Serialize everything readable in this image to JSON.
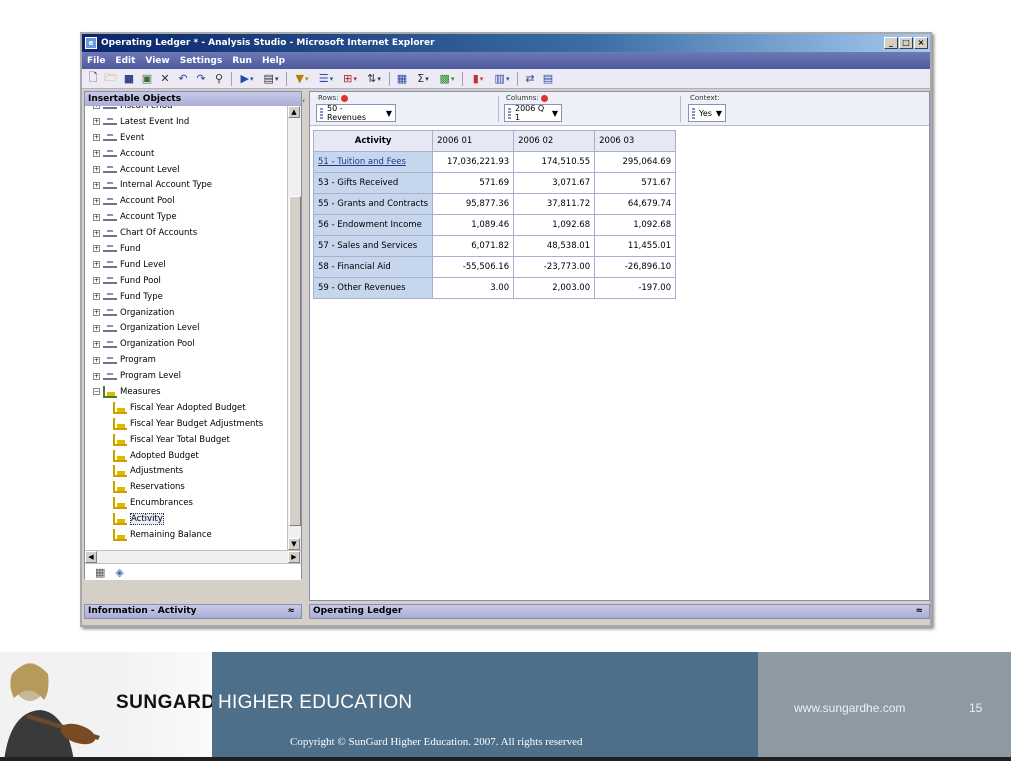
{
  "window": {
    "title": "Operating Ledger * - Analysis Studio - Microsoft Internet Explorer"
  },
  "menu": [
    "File",
    "Edit",
    "View",
    "Settings",
    "Run",
    "Help"
  ],
  "toolbar_icons": [
    "new-icon",
    "open-icon",
    "save-icon",
    "save-as-icon",
    "delete-icon",
    "undo-icon",
    "redo-icon",
    "find-icon",
    "run-icon",
    "export-icon",
    "filter-icon",
    "suppress-icon",
    "calc-icon",
    "sort-icon",
    "rank-icon",
    "sum-icon",
    "explore-icon",
    "chart-icon",
    "chart-type-icon",
    "swap-icon",
    "properties-icon"
  ],
  "insertable": {
    "title": "Insertable Objects",
    "items": [
      {
        "label": "Fiscal Period",
        "kind": "dim",
        "level": 1
      },
      {
        "label": "Latest Event Ind",
        "kind": "dim",
        "level": 1
      },
      {
        "label": "Event",
        "kind": "dim",
        "level": 1
      },
      {
        "label": "Account",
        "kind": "dim",
        "level": 1
      },
      {
        "label": "Account Level",
        "kind": "dim",
        "level": 1
      },
      {
        "label": "Internal Account Type",
        "kind": "dim",
        "level": 1
      },
      {
        "label": "Account Pool",
        "kind": "dim",
        "level": 1
      },
      {
        "label": "Account Type",
        "kind": "dim",
        "level": 1
      },
      {
        "label": "Chart Of Accounts",
        "kind": "dim",
        "level": 1
      },
      {
        "label": "Fund",
        "kind": "dim",
        "level": 1
      },
      {
        "label": "Fund Level",
        "kind": "dim",
        "level": 1
      },
      {
        "label": "Fund Pool",
        "kind": "dim",
        "level": 1
      },
      {
        "label": "Fund Type",
        "kind": "dim",
        "level": 1
      },
      {
        "label": "Organization",
        "kind": "dim",
        "level": 1
      },
      {
        "label": "Organization Level",
        "kind": "dim",
        "level": 1
      },
      {
        "label": "Organization Pool",
        "kind": "dim",
        "level": 1
      },
      {
        "label": "Program",
        "kind": "dim",
        "level": 1
      },
      {
        "label": "Program Level",
        "kind": "dim",
        "level": 1
      },
      {
        "label": "Measures",
        "kind": "folder",
        "level": 1
      },
      {
        "label": "Fiscal Year Adopted Budget",
        "kind": "measure",
        "level": 2
      },
      {
        "label": "Fiscal Year Budget Adjustments",
        "kind": "measure",
        "level": 2
      },
      {
        "label": "Fiscal Year Total Budget",
        "kind": "measure",
        "level": 2
      },
      {
        "label": "Adopted Budget",
        "kind": "measure",
        "level": 2
      },
      {
        "label": "Adjustments",
        "kind": "measure",
        "level": 2
      },
      {
        "label": "Reservations",
        "kind": "measure",
        "level": 2
      },
      {
        "label": "Encumbrances",
        "kind": "measure",
        "level": 2
      },
      {
        "label": "Activity",
        "kind": "measure",
        "level": 2,
        "selected": true
      },
      {
        "label": "Remaining Balance",
        "kind": "measure",
        "level": 2
      }
    ]
  },
  "info_panel": {
    "title": "Information - Activity"
  },
  "drop_zones": {
    "rows_label": "Rows:",
    "rows_value": "50 - Revenues",
    "columns_label": "Columns:",
    "columns_value": "2006 Q 1",
    "context_label": "Context:",
    "context_value": "Yes"
  },
  "crosstab": {
    "corner": "Activity",
    "columns": [
      "2006 01",
      "2006 02",
      "2006 03"
    ],
    "rows": [
      {
        "label": "51 - Tuition and Fees",
        "values": [
          "17,036,221.93",
          "174,510.55",
          "295,064.69"
        ],
        "link": true
      },
      {
        "label": "53 - Gifts Received",
        "values": [
          "571.69",
          "3,071.67",
          "571.67"
        ]
      },
      {
        "label": "55 - Grants and Contracts",
        "values": [
          "95,877.36",
          "37,811.72",
          "64,679.74"
        ]
      },
      {
        "label": "56 - Endowment Income",
        "values": [
          "1,089.46",
          "1,092.68",
          "1,092.68"
        ]
      },
      {
        "label": "57 - Sales and Services",
        "values": [
          "6,071.82",
          "48,538.01",
          "11,455.01"
        ]
      },
      {
        "label": "58 - Financial Aid",
        "values": [
          "-55,506.16",
          "-23,773.00",
          "-26,896.10"
        ]
      },
      {
        "label": "59 - Other Revenues",
        "values": [
          "3.00",
          "2,003.00",
          "-197.00"
        ]
      }
    ]
  },
  "bottom_panel": {
    "title": "Operating Ledger"
  },
  "footer": {
    "logo": "SUNGARD",
    "brand": "HIGHER EDUCATION",
    "website": "www.sungardhe.com",
    "page": "15",
    "copyright": "Copyright © SunGard Higher Education.  2007.  All rights reserved"
  },
  "colors": {
    "menubar": "#4f5a9e",
    "footer_band": "#4e6f89",
    "footer_gray": "#8d9aa2",
    "row_header": "#c6d6ec"
  }
}
